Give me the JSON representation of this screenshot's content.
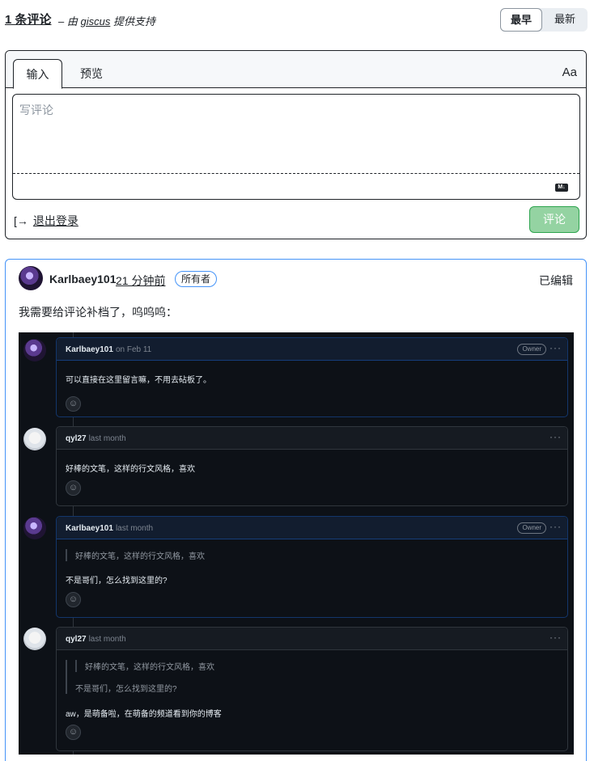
{
  "header": {
    "count_label": "1 条评论",
    "by_prefix": "– 由 ",
    "by_link": "giscus",
    "by_suffix": " 提供支持",
    "sort_oldest": "最早",
    "sort_newest": "最新"
  },
  "composer": {
    "tab_write": "输入",
    "tab_preview": "预览",
    "font_toggle": "Aa",
    "placeholder": "写评论",
    "markdown_badge": "M↓",
    "signout_icon": "[→",
    "signout_label": "退出登录",
    "submit_label": "评论",
    "colors": {
      "submit_bg": "#94d3a2",
      "submit_border": "#2da44e"
    }
  },
  "comment": {
    "author": "Karlbaey101",
    "time": "21 分钟前",
    "badge": "所有者",
    "edited": "已编辑",
    "body": "我需要给评论补档了，呜呜呜：",
    "colors": {
      "card_border": "#4493f8"
    }
  },
  "embedded": {
    "dots": "···",
    "react_icon": "☺",
    "items": [
      {
        "author": "Karlbaey101",
        "time": "on Feb 11",
        "owner": "Owner",
        "text": "可以直接在这里留言嘛，不用去砧板了。"
      },
      {
        "author": "qyl27",
        "time": "last month",
        "text": "好棒的文笔，这样的行文风格，喜欢"
      },
      {
        "author": "Karlbaey101",
        "time": "last month",
        "owner": "Owner",
        "quote": "好棒的文笔，这样的行文风格，喜欢",
        "text": "不是哥们，怎么找到这里的?"
      },
      {
        "author": "qyl27",
        "time": "last month",
        "quote_inner": "好棒的文笔，这样的行文风格，喜欢",
        "quote": "不是哥们，怎么找到这里的?",
        "text": "aw，是萌备啦，在萌备的频道看到你的博客"
      }
    ]
  }
}
